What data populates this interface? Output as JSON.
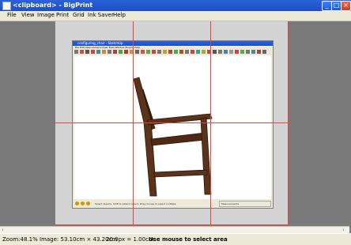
{
  "window": {
    "title": "<clipboard> - BigPrint"
  },
  "menu": [
    "File",
    "View",
    "Image",
    "Print",
    "Grid",
    "Ink Saver",
    "Help"
  ],
  "embedded": {
    "title": "configuring_chair - SketchUp",
    "menu": "File   Edit   View   Camera   Draw   Tools   Window   Plugins   Help",
    "status": "Select objects. Shift to extend select. Drag mouse to select multiple.",
    "measurements": "Measurements"
  },
  "status": {
    "zoom": "Zoom:48.1%",
    "image": "Image: 53.10cm × 43.20cm",
    "scale": "20.0px = 1.00cm",
    "hint": "Use mouse to select area"
  }
}
